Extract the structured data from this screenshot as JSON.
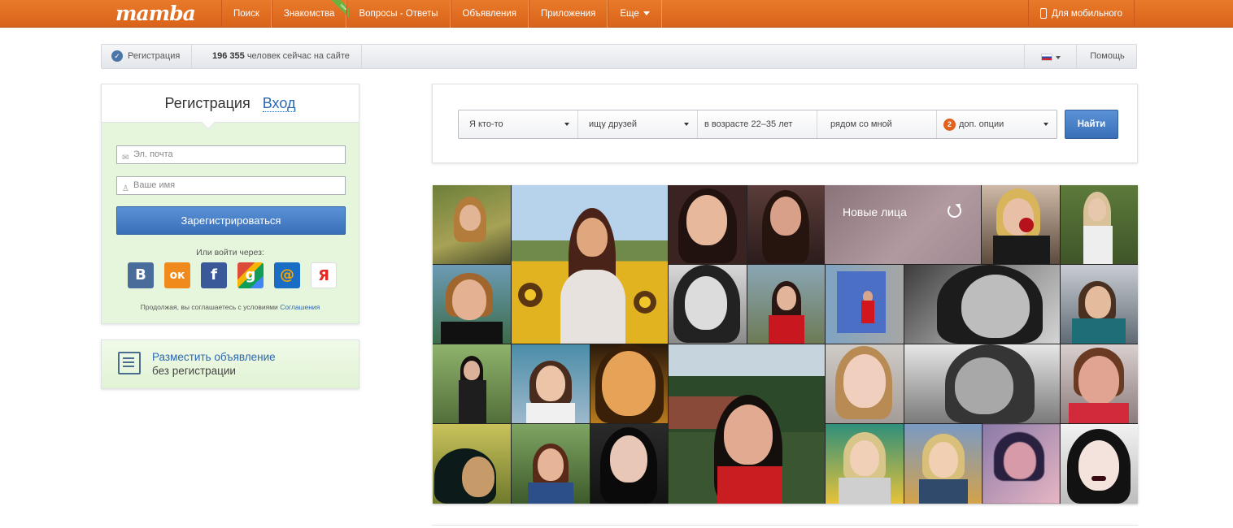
{
  "header": {
    "logo": "mamba",
    "nav": [
      {
        "label": "Поиск"
      },
      {
        "label": "Знакомства",
        "badge": "new"
      },
      {
        "label": "Вопросы - Ответы"
      },
      {
        "label": "Объявления"
      },
      {
        "label": "Приложения"
      },
      {
        "label": "Еще"
      }
    ],
    "mobile_label": "Для мобильного"
  },
  "infobar": {
    "registration_label": "Регистрация",
    "online_count": "196 355",
    "online_text": "человек сейчас на сайте",
    "help_label": "Помощь"
  },
  "registration": {
    "tab_register": "Регистрация",
    "tab_login": "Вход",
    "email_placeholder": "Эл. почта",
    "name_placeholder": "Ваше имя",
    "submit_label": "Зарегистрироваться",
    "or_login_via": "Или войти через:",
    "social": [
      {
        "name": "vkontakte",
        "glyph": "В"
      },
      {
        "name": "odnoklassniki",
        "glyph": "ок"
      },
      {
        "name": "facebook",
        "glyph": "f"
      },
      {
        "name": "google",
        "glyph": "g"
      },
      {
        "name": "mail-ru",
        "glyph": "@"
      },
      {
        "name": "yandex",
        "glyph": "Я"
      }
    ],
    "terms_text": "Продолжая, вы соглашаетесь с условиями",
    "terms_link": "Соглашения"
  },
  "ad": {
    "link": "Разместить объявление",
    "sub": "без регистрации"
  },
  "search": {
    "who": "Я кто-то",
    "seeking": "ищу друзей",
    "age_prefix": "в возрасте",
    "age_from": "22",
    "age_sep": "–",
    "age_to": "35",
    "age_suffix": "лет",
    "location": "рядом со мной",
    "options_count": "2",
    "options_label": "доп. опции",
    "find_label": "Найти"
  },
  "new_faces_label": "Новые лица",
  "colors": {
    "header_orange": "#e0621c",
    "link_blue": "#2b67b2",
    "button_blue": "#3a6fb8",
    "panel_green": "#e6f6dc"
  }
}
